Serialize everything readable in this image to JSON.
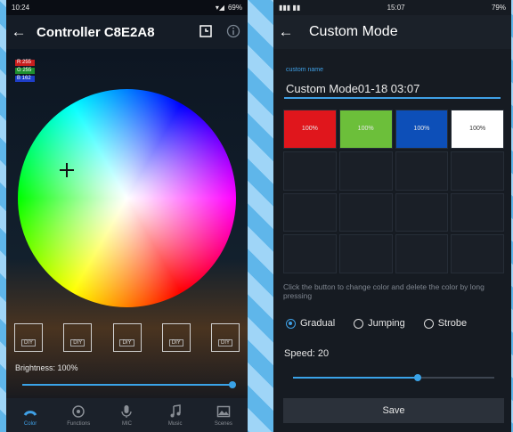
{
  "left": {
    "status": {
      "time": "10:24",
      "battery": "69%"
    },
    "topbar": {
      "title": "Controller  C8E2A8"
    },
    "rgb_badges": [
      {
        "label": "R 255",
        "color": "#c81e1e"
      },
      {
        "label": "G 255",
        "color": "#1e8e2e"
      },
      {
        "label": "B 162",
        "color": "#1e3ec8"
      }
    ],
    "diy_buttons": [
      "DIY",
      "DIY",
      "DIY",
      "DIY",
      "DIY"
    ],
    "brightness_label": "Brightness: 100%",
    "brightness": 1.0,
    "nav": [
      {
        "label": "Color",
        "icon": "color-wheel-icon",
        "active": true
      },
      {
        "label": "Functions",
        "icon": "functions-icon",
        "active": false
      },
      {
        "label": "MIC",
        "icon": "mic-icon",
        "active": false
      },
      {
        "label": "Music",
        "icon": "music-note-icon",
        "active": false
      },
      {
        "label": "Scenes",
        "icon": "scenes-icon",
        "active": false
      }
    ]
  },
  "right": {
    "status": {
      "time": "15:07",
      "battery": "79%"
    },
    "topbar": {
      "title": "Custom Mode"
    },
    "field_label": "custom name",
    "name_value": "Custom Mode01-18 03:07",
    "color_cells": [
      {
        "label": "100%",
        "color": "#e0161c",
        "text_color": "#e8e8e8"
      },
      {
        "label": "100%",
        "color": "#6cbf3a",
        "text_color": "#e8e8e8"
      },
      {
        "label": "100%",
        "color": "#0d4fb8",
        "text_color": "#e8e8e8"
      },
      {
        "label": "100%",
        "color": "#ffffff",
        "text_color": "#333333"
      }
    ],
    "hint": "Click the button to change color and delete the color by long pressing",
    "modes": [
      {
        "label": "Gradual",
        "checked": true
      },
      {
        "label": "Jumping",
        "checked": false
      },
      {
        "label": "Strobe",
        "checked": false
      }
    ],
    "speed_label": "Speed: 20",
    "speed_fraction": 0.62,
    "save_label": "Save"
  }
}
